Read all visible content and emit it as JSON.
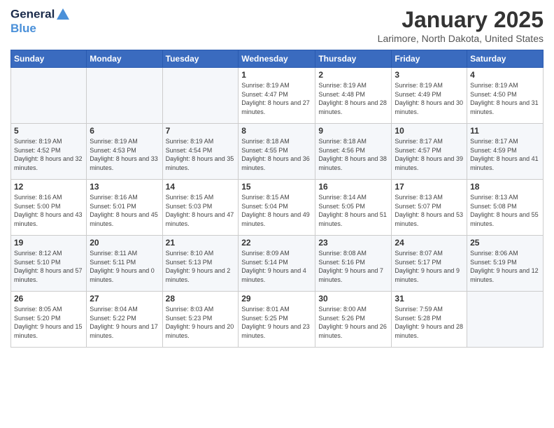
{
  "header": {
    "logo_line1": "General",
    "logo_line2": "Blue",
    "month": "January 2025",
    "location": "Larimore, North Dakota, United States"
  },
  "weekdays": [
    "Sunday",
    "Monday",
    "Tuesday",
    "Wednesday",
    "Thursday",
    "Friday",
    "Saturday"
  ],
  "weeks": [
    [
      {
        "day": "",
        "info": ""
      },
      {
        "day": "",
        "info": ""
      },
      {
        "day": "",
        "info": ""
      },
      {
        "day": "1",
        "info": "Sunrise: 8:19 AM\nSunset: 4:47 PM\nDaylight: 8 hours and 27 minutes."
      },
      {
        "day": "2",
        "info": "Sunrise: 8:19 AM\nSunset: 4:48 PM\nDaylight: 8 hours and 28 minutes."
      },
      {
        "day": "3",
        "info": "Sunrise: 8:19 AM\nSunset: 4:49 PM\nDaylight: 8 hours and 30 minutes."
      },
      {
        "day": "4",
        "info": "Sunrise: 8:19 AM\nSunset: 4:50 PM\nDaylight: 8 hours and 31 minutes."
      }
    ],
    [
      {
        "day": "5",
        "info": "Sunrise: 8:19 AM\nSunset: 4:52 PM\nDaylight: 8 hours and 32 minutes."
      },
      {
        "day": "6",
        "info": "Sunrise: 8:19 AM\nSunset: 4:53 PM\nDaylight: 8 hours and 33 minutes."
      },
      {
        "day": "7",
        "info": "Sunrise: 8:19 AM\nSunset: 4:54 PM\nDaylight: 8 hours and 35 minutes."
      },
      {
        "day": "8",
        "info": "Sunrise: 8:18 AM\nSunset: 4:55 PM\nDaylight: 8 hours and 36 minutes."
      },
      {
        "day": "9",
        "info": "Sunrise: 8:18 AM\nSunset: 4:56 PM\nDaylight: 8 hours and 38 minutes."
      },
      {
        "day": "10",
        "info": "Sunrise: 8:17 AM\nSunset: 4:57 PM\nDaylight: 8 hours and 39 minutes."
      },
      {
        "day": "11",
        "info": "Sunrise: 8:17 AM\nSunset: 4:59 PM\nDaylight: 8 hours and 41 minutes."
      }
    ],
    [
      {
        "day": "12",
        "info": "Sunrise: 8:16 AM\nSunset: 5:00 PM\nDaylight: 8 hours and 43 minutes."
      },
      {
        "day": "13",
        "info": "Sunrise: 8:16 AM\nSunset: 5:01 PM\nDaylight: 8 hours and 45 minutes."
      },
      {
        "day": "14",
        "info": "Sunrise: 8:15 AM\nSunset: 5:03 PM\nDaylight: 8 hours and 47 minutes."
      },
      {
        "day": "15",
        "info": "Sunrise: 8:15 AM\nSunset: 5:04 PM\nDaylight: 8 hours and 49 minutes."
      },
      {
        "day": "16",
        "info": "Sunrise: 8:14 AM\nSunset: 5:05 PM\nDaylight: 8 hours and 51 minutes."
      },
      {
        "day": "17",
        "info": "Sunrise: 8:13 AM\nSunset: 5:07 PM\nDaylight: 8 hours and 53 minutes."
      },
      {
        "day": "18",
        "info": "Sunrise: 8:13 AM\nSunset: 5:08 PM\nDaylight: 8 hours and 55 minutes."
      }
    ],
    [
      {
        "day": "19",
        "info": "Sunrise: 8:12 AM\nSunset: 5:10 PM\nDaylight: 8 hours and 57 minutes."
      },
      {
        "day": "20",
        "info": "Sunrise: 8:11 AM\nSunset: 5:11 PM\nDaylight: 9 hours and 0 minutes."
      },
      {
        "day": "21",
        "info": "Sunrise: 8:10 AM\nSunset: 5:13 PM\nDaylight: 9 hours and 2 minutes."
      },
      {
        "day": "22",
        "info": "Sunrise: 8:09 AM\nSunset: 5:14 PM\nDaylight: 9 hours and 4 minutes."
      },
      {
        "day": "23",
        "info": "Sunrise: 8:08 AM\nSunset: 5:16 PM\nDaylight: 9 hours and 7 minutes."
      },
      {
        "day": "24",
        "info": "Sunrise: 8:07 AM\nSunset: 5:17 PM\nDaylight: 9 hours and 9 minutes."
      },
      {
        "day": "25",
        "info": "Sunrise: 8:06 AM\nSunset: 5:19 PM\nDaylight: 9 hours and 12 minutes."
      }
    ],
    [
      {
        "day": "26",
        "info": "Sunrise: 8:05 AM\nSunset: 5:20 PM\nDaylight: 9 hours and 15 minutes."
      },
      {
        "day": "27",
        "info": "Sunrise: 8:04 AM\nSunset: 5:22 PM\nDaylight: 9 hours and 17 minutes."
      },
      {
        "day": "28",
        "info": "Sunrise: 8:03 AM\nSunset: 5:23 PM\nDaylight: 9 hours and 20 minutes."
      },
      {
        "day": "29",
        "info": "Sunrise: 8:01 AM\nSunset: 5:25 PM\nDaylight: 9 hours and 23 minutes."
      },
      {
        "day": "30",
        "info": "Sunrise: 8:00 AM\nSunset: 5:26 PM\nDaylight: 9 hours and 26 minutes."
      },
      {
        "day": "31",
        "info": "Sunrise: 7:59 AM\nSunset: 5:28 PM\nDaylight: 9 hours and 28 minutes."
      },
      {
        "day": "",
        "info": ""
      }
    ]
  ]
}
